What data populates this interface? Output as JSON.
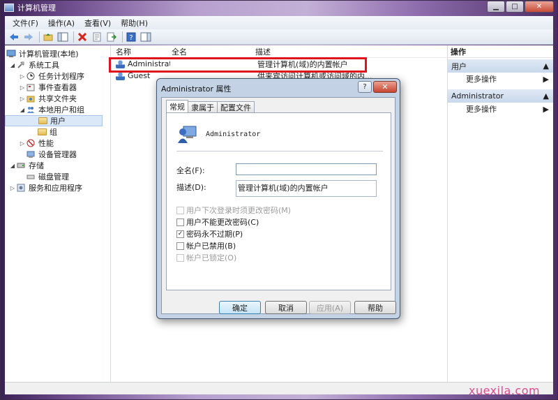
{
  "window": {
    "title": "计算机管理"
  },
  "window_controls": {
    "minimize": "▁",
    "maximize": "□",
    "close": "✕"
  },
  "menu": [
    "文件(F)",
    "操作(A)",
    "查看(V)",
    "帮助(H)"
  ],
  "tree": {
    "root": "计算机管理(本地)",
    "system_tools": "系统工具",
    "task_scheduler": "任务计划程序",
    "event_viewer": "事件查看器",
    "shared_folders": "共享文件夹",
    "local_users_groups": "本地用户和组",
    "users": "用户",
    "groups": "组",
    "performance": "性能",
    "device_manager": "设备管理器",
    "storage": "存储",
    "disk_management": "磁盘管理",
    "services_apps": "服务和应用程序"
  },
  "list": {
    "headers": {
      "name": "名称",
      "fullname": "全名",
      "description": "描述"
    },
    "rows": [
      {
        "name": "Administrat...",
        "fullname": "",
        "description": "管理计算机(域)的内置帐户"
      },
      {
        "name": "Guest",
        "fullname": "",
        "description": "供来宾访问计算机或访问域的内..."
      }
    ]
  },
  "actions": {
    "title": "操作",
    "section1": "用户",
    "more1": "更多操作",
    "section2": "Administrator",
    "more2": "更多操作"
  },
  "dialog": {
    "title": "Administrator 属性",
    "help": "?",
    "close": "✕",
    "tabs": [
      "常规",
      "隶属于",
      "配置文件"
    ],
    "account_name": "Administrator",
    "fullname_label": "全名(F):",
    "fullname_value": "",
    "description_label": "描述(D):",
    "description_value": "管理计算机(域)的内置帐户",
    "checkboxes": [
      {
        "label": "用户下次登录时须更改密码(M)",
        "checked": false,
        "disabled": true
      },
      {
        "label": "用户不能更改密码(C)",
        "checked": false,
        "disabled": false
      },
      {
        "label": "密码永不过期(P)",
        "checked": true,
        "disabled": false
      },
      {
        "label": "帐户已禁用(B)",
        "checked": false,
        "disabled": false
      },
      {
        "label": "帐户已锁定(O)",
        "checked": false,
        "disabled": true
      }
    ],
    "check_mark": "✓",
    "buttons": {
      "ok": "确定",
      "cancel": "取消",
      "apply": "应用(A)",
      "help": "帮助"
    }
  },
  "watermark": "xuexila.com",
  "colors": {
    "highlight": "#e0141c",
    "selection": "#dbe8f8",
    "action_section": "#c9d8ec"
  }
}
